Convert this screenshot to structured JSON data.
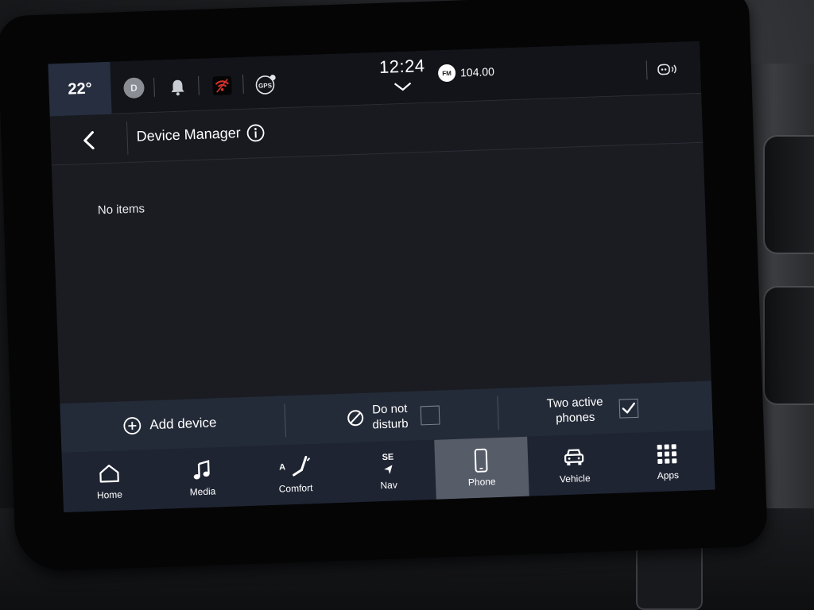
{
  "status_bar": {
    "temperature": "22°",
    "profile_initial": "D",
    "time": "12:24",
    "radio_band": "FM",
    "radio_frequency": "104.00",
    "gps_label": "GPS"
  },
  "header": {
    "title": "Device Manager"
  },
  "content": {
    "empty_message": "No items"
  },
  "actions": {
    "add_device": "Add device",
    "do_not_disturb_line1": "Do not",
    "do_not_disturb_line2": "disturb",
    "do_not_disturb_checked": false,
    "two_active_line1": "Two active",
    "two_active_line2": "phones",
    "two_active_checked": true
  },
  "nav": {
    "items": [
      {
        "label": "Home",
        "icon": "home-icon"
      },
      {
        "label": "Media",
        "icon": "music-note-icon"
      },
      {
        "label": "Comfort",
        "icon": "seat-icon",
        "badge": "A"
      },
      {
        "label": "Nav",
        "icon": "compass-arrow-icon",
        "badge": "SE"
      },
      {
        "label": "Phone",
        "icon": "phone-icon",
        "active": true
      },
      {
        "label": "Vehicle",
        "icon": "car-icon"
      },
      {
        "label": "Apps",
        "icon": "apps-grid-icon"
      }
    ]
  },
  "colors": {
    "screen_bg": "#1a1c22",
    "status_bar_bg": "#121419",
    "temp_box_bg": "#262e40",
    "action_bar_bg": "#242b38",
    "nav_bar_bg": "#1e2432",
    "nav_active_bg": "#565c68",
    "wifi_red": "#d8322b"
  }
}
